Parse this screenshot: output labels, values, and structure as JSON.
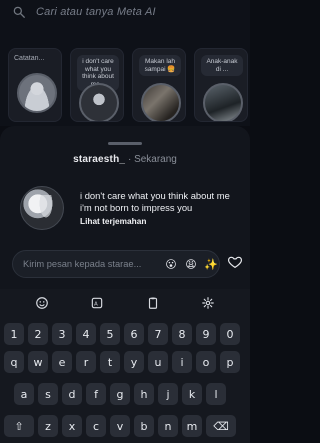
{
  "search": {
    "placeholder": "Cari atau tanya Meta AI"
  },
  "stories": [
    {
      "caption": "Catatan..."
    },
    {
      "caption": "i don't care what you think about me..."
    },
    {
      "caption": "Makan lah sampai 🍔"
    },
    {
      "caption": "Anak-anak di ..."
    }
  ],
  "sheet": {
    "username": "staraesth_",
    "separator": "·",
    "time": "Sekarang",
    "quote_line1": "i don't care what you think about me",
    "quote_line2": "i'm not born to impress you",
    "translate_label": "Lihat terjemahan"
  },
  "reply": {
    "placeholder": "Kirim pesan kepada starae...",
    "emoji1": "😮",
    "emoji2": "😩",
    "emoji3": "✨",
    "heart_icon": "heart-outline-icon"
  },
  "keyboard": {
    "toolbar_icons": [
      "smiley-icon",
      "ai-translate-icon",
      "clipboard-icon",
      "gear-icon"
    ],
    "row_numbers": [
      "1",
      "2",
      "3",
      "4",
      "5",
      "6",
      "7",
      "8",
      "9",
      "0"
    ],
    "row_top": [
      "q",
      "w",
      "e",
      "r",
      "t",
      "y",
      "u",
      "i",
      "o",
      "p"
    ],
    "row_mid": [
      "a",
      "s",
      "d",
      "f",
      "g",
      "h",
      "j",
      "k",
      "l"
    ],
    "row_bottom": [
      "⇧",
      "z",
      "x",
      "c",
      "v",
      "b",
      "n",
      "m",
      "⌫"
    ]
  }
}
